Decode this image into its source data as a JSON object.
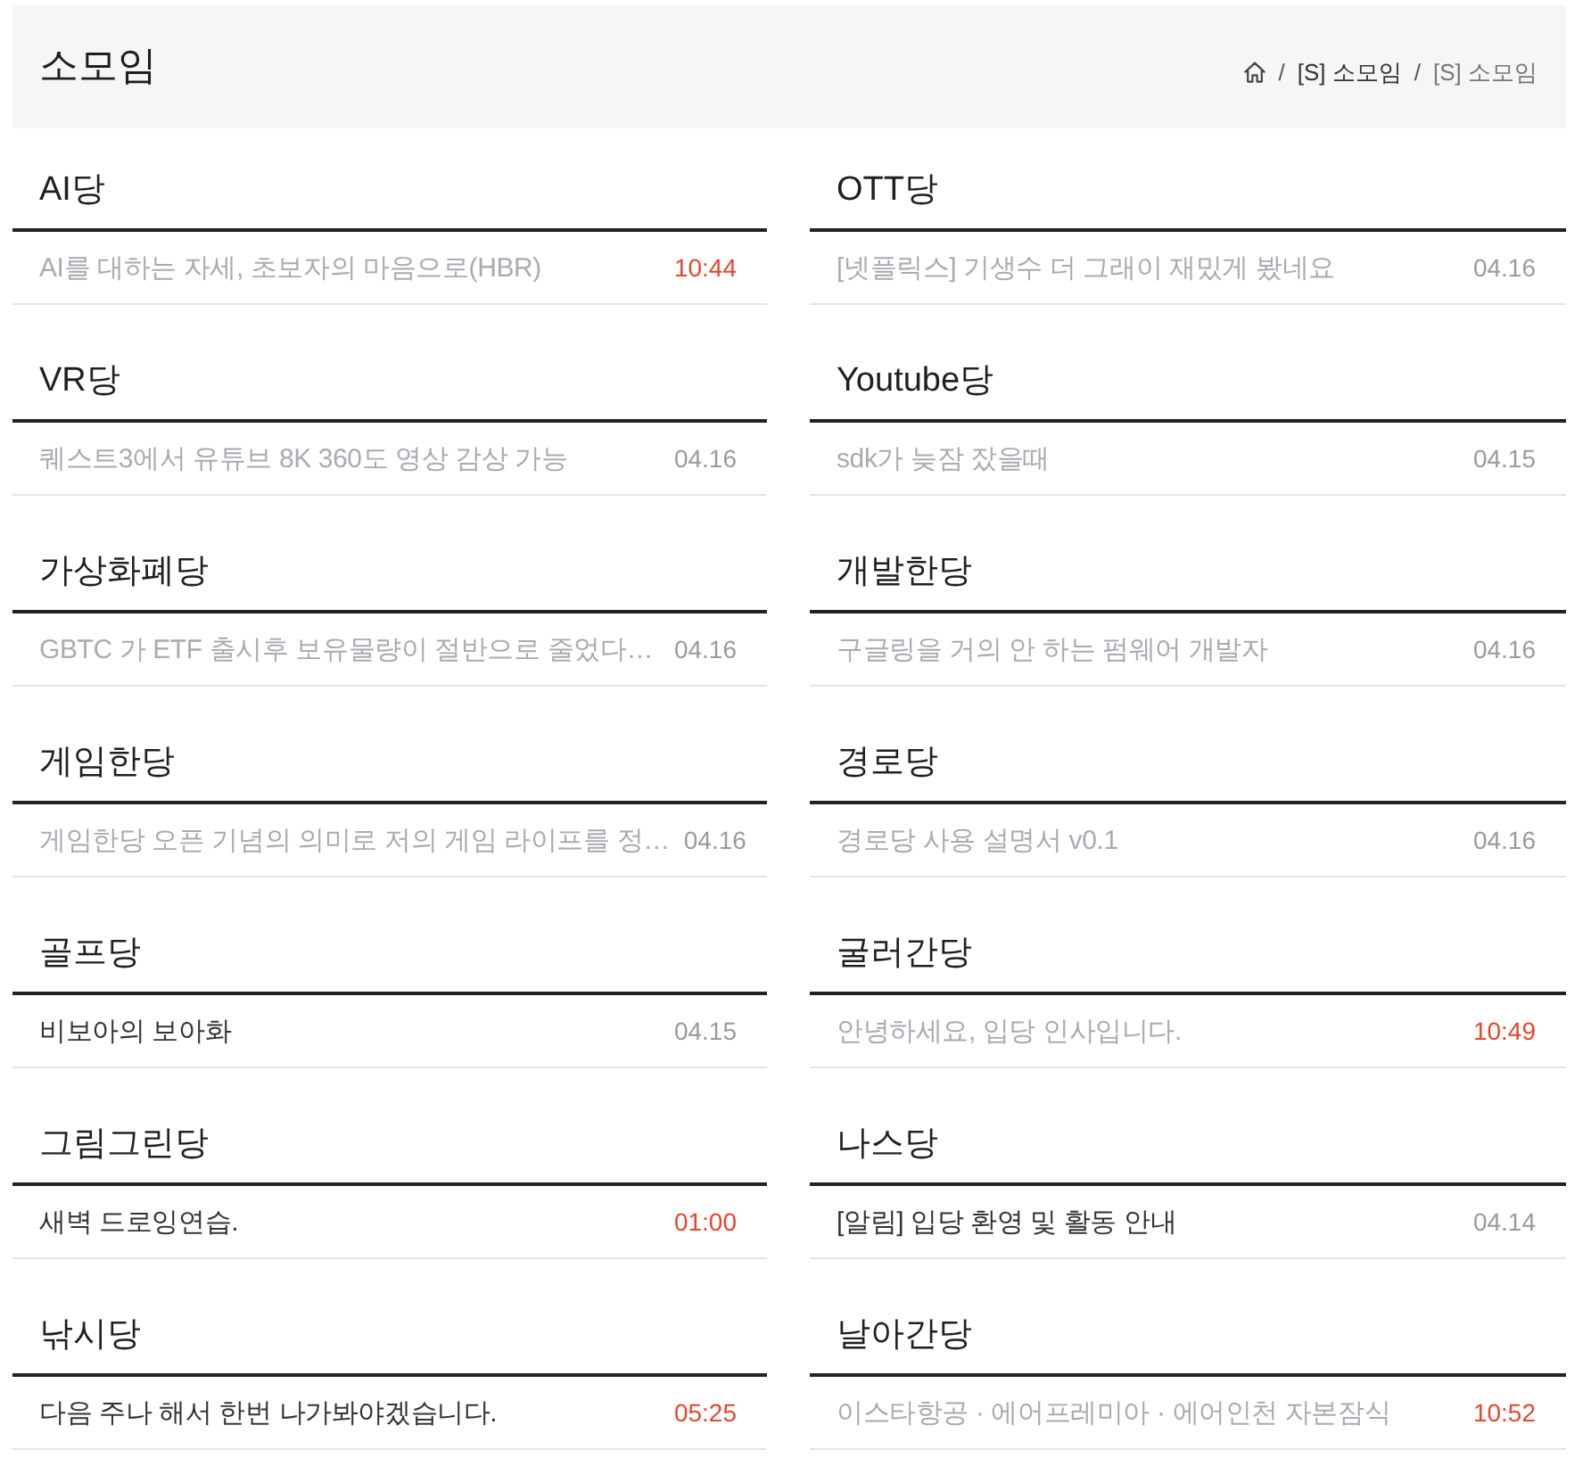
{
  "header": {
    "title": "소모임",
    "breadcrumb": [
      {
        "separator": "/",
        "label": "[S] 소모임",
        "current": false
      },
      {
        "separator": "/",
        "label": "[S] 소모임",
        "current": true
      }
    ]
  },
  "sections": [
    {
      "name": "AI당",
      "post": {
        "title": "AI를 대하는 자세, 초보자의 마음으로(HBR)",
        "date": "10:44",
        "read": true,
        "recent": true
      }
    },
    {
      "name": "OTT당",
      "post": {
        "title": "[넷플릭스] 기생수 더 그래이 재밌게 봤네요",
        "date": "04.16",
        "read": true,
        "recent": false
      }
    },
    {
      "name": "VR당",
      "post": {
        "title": "퀘스트3에서 유튜브 8K 360도 영상 감상 가능",
        "date": "04.16",
        "read": true,
        "recent": false
      }
    },
    {
      "name": "Youtube당",
      "post": {
        "title": "sdk가 늦잠 잤을때",
        "date": "04.15",
        "read": true,
        "recent": false
      }
    },
    {
      "name": "가상화폐당",
      "post": {
        "title": "GBTC 가 ETF 출시후 보유물량이 절반으로 줄었다…",
        "date": "04.16",
        "read": true,
        "recent": false
      }
    },
    {
      "name": "개발한당",
      "post": {
        "title": "구글링을 거의 안 하는 펌웨어 개발자",
        "date": "04.16",
        "read": true,
        "recent": false
      }
    },
    {
      "name": "게임한당",
      "post": {
        "title": "게임한당 오픈 기념의 의미로 저의 게임 라이프를 정…",
        "date": "04.16",
        "read": true,
        "recent": false
      }
    },
    {
      "name": "경로당",
      "post": {
        "title": "경로당 사용 설명서 v0.1",
        "date": "04.16",
        "read": true,
        "recent": false
      }
    },
    {
      "name": "골프당",
      "post": {
        "title": "비보아의 보아화",
        "date": "04.15",
        "read": false,
        "recent": false
      }
    },
    {
      "name": "굴러간당",
      "post": {
        "title": "안녕하세요, 입당 인사입니다.",
        "date": "10:49",
        "read": true,
        "recent": true
      }
    },
    {
      "name": "그림그린당",
      "post": {
        "title": "새벽 드로잉연습.",
        "date": "01:00",
        "read": false,
        "recent": true
      }
    },
    {
      "name": "나스당",
      "post": {
        "title": "[알림] 입당 환영 및 활동 안내",
        "date": "04.14",
        "read": false,
        "recent": false
      }
    },
    {
      "name": "낚시당",
      "post": {
        "title": "다음 주나 해서 한번 나가봐야겠습니다.",
        "date": "05:25",
        "read": false,
        "recent": true
      }
    },
    {
      "name": "날아간당",
      "post": {
        "title": "이스타항공 · 에어프레미아 · 에어인천 자본잠식",
        "date": "10:52",
        "read": true,
        "recent": true
      }
    }
  ]
}
